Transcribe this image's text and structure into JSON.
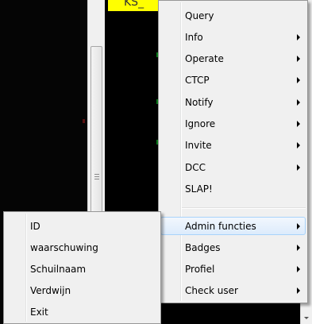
{
  "channel_tab": {
    "label": "KS_"
  },
  "main_menu": {
    "items": [
      {
        "label": "Query",
        "submenu": false
      },
      {
        "label": "Info",
        "submenu": true
      },
      {
        "label": "Operate",
        "submenu": true
      },
      {
        "label": "CTCP",
        "submenu": true
      },
      {
        "label": "Notify",
        "submenu": true
      },
      {
        "label": "Ignore",
        "submenu": true
      },
      {
        "label": "Invite",
        "submenu": true
      },
      {
        "label": "DCC",
        "submenu": true
      },
      {
        "label": "SLAP!",
        "submenu": false
      },
      {
        "label": "Admin functies",
        "submenu": true,
        "highlighted": true
      },
      {
        "label": "Badges",
        "submenu": true
      },
      {
        "label": "Profiel",
        "submenu": true
      },
      {
        "label": "Check user",
        "submenu": true
      }
    ]
  },
  "admin_submenu": {
    "items": [
      {
        "label": "ID"
      },
      {
        "label": "waarschuwing"
      },
      {
        "label": "Schuilnaam"
      },
      {
        "label": "Verdwijn"
      },
      {
        "label": "Exit"
      }
    ]
  },
  "colors": {
    "highlight_border": "#a8d3fb",
    "tab_yellow": "#ffff00"
  }
}
